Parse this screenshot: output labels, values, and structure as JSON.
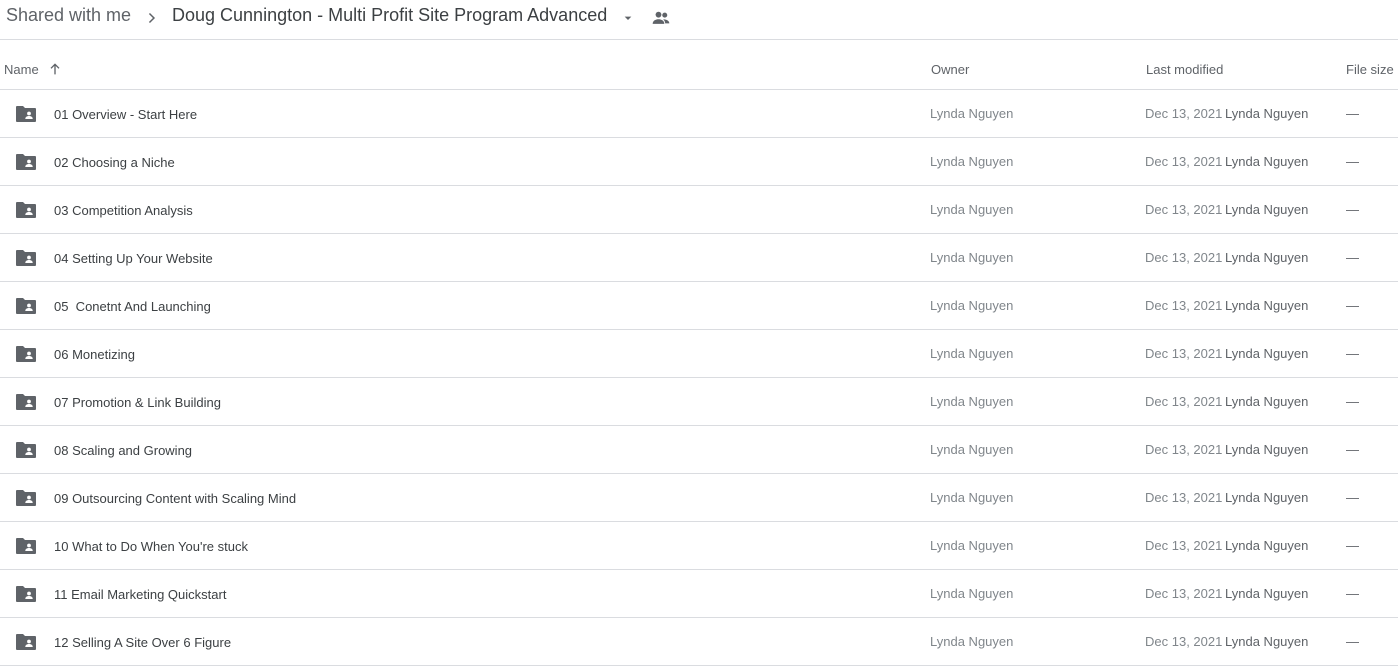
{
  "breadcrumb": {
    "root": "Shared with me",
    "current": "Doug Cunnington - Multi Profit Site Program Advanced"
  },
  "icons": {
    "separator": "chevron-right-icon",
    "dropdown": "caret-down-icon",
    "shared": "people-icon",
    "sort": "arrow-up-icon",
    "folder": "shared-folder-icon"
  },
  "columns": {
    "name": "Name",
    "owner": "Owner",
    "last_modified": "Last modified",
    "file_size": "File size"
  },
  "colors": {
    "folder_icon": "#5f6368",
    "divider": "#dadce0"
  },
  "rows": [
    {
      "name": "01 Overview - Start Here",
      "owner": "Lynda Nguyen",
      "date": "Dec 13, 2021",
      "modified_by": "Lynda Nguyen",
      "size": "—"
    },
    {
      "name": "02 Choosing a Niche",
      "owner": "Lynda Nguyen",
      "date": "Dec 13, 2021",
      "modified_by": "Lynda Nguyen",
      "size": "—"
    },
    {
      "name": "03 Competition Analysis",
      "owner": "Lynda Nguyen",
      "date": "Dec 13, 2021",
      "modified_by": "Lynda Nguyen",
      "size": "—"
    },
    {
      "name": "04 Setting Up Your Website",
      "owner": "Lynda Nguyen",
      "date": "Dec 13, 2021",
      "modified_by": "Lynda Nguyen",
      "size": "—"
    },
    {
      "name": "05  Conetnt And Launching",
      "owner": "Lynda Nguyen",
      "date": "Dec 13, 2021",
      "modified_by": "Lynda Nguyen",
      "size": "—"
    },
    {
      "name": "06 Monetizing",
      "owner": "Lynda Nguyen",
      "date": "Dec 13, 2021",
      "modified_by": "Lynda Nguyen",
      "size": "—"
    },
    {
      "name": "07 Promotion & Link Building",
      "owner": "Lynda Nguyen",
      "date": "Dec 13, 2021",
      "modified_by": "Lynda Nguyen",
      "size": "—"
    },
    {
      "name": "08 Scaling and Growing",
      "owner": "Lynda Nguyen",
      "date": "Dec 13, 2021",
      "modified_by": "Lynda Nguyen",
      "size": "—"
    },
    {
      "name": "09 Outsourcing Content with Scaling Mind",
      "owner": "Lynda Nguyen",
      "date": "Dec 13, 2021",
      "modified_by": "Lynda Nguyen",
      "size": "—"
    },
    {
      "name": "10 What to Do When You're stuck",
      "owner": "Lynda Nguyen",
      "date": "Dec 13, 2021",
      "modified_by": "Lynda Nguyen",
      "size": "—"
    },
    {
      "name": "11 Email Marketing Quickstart",
      "owner": "Lynda Nguyen",
      "date": "Dec 13, 2021",
      "modified_by": "Lynda Nguyen",
      "size": "—"
    },
    {
      "name": "12 Selling A Site Over 6 Figure",
      "owner": "Lynda Nguyen",
      "date": "Dec 13, 2021",
      "modified_by": "Lynda Nguyen",
      "size": "—"
    }
  ]
}
